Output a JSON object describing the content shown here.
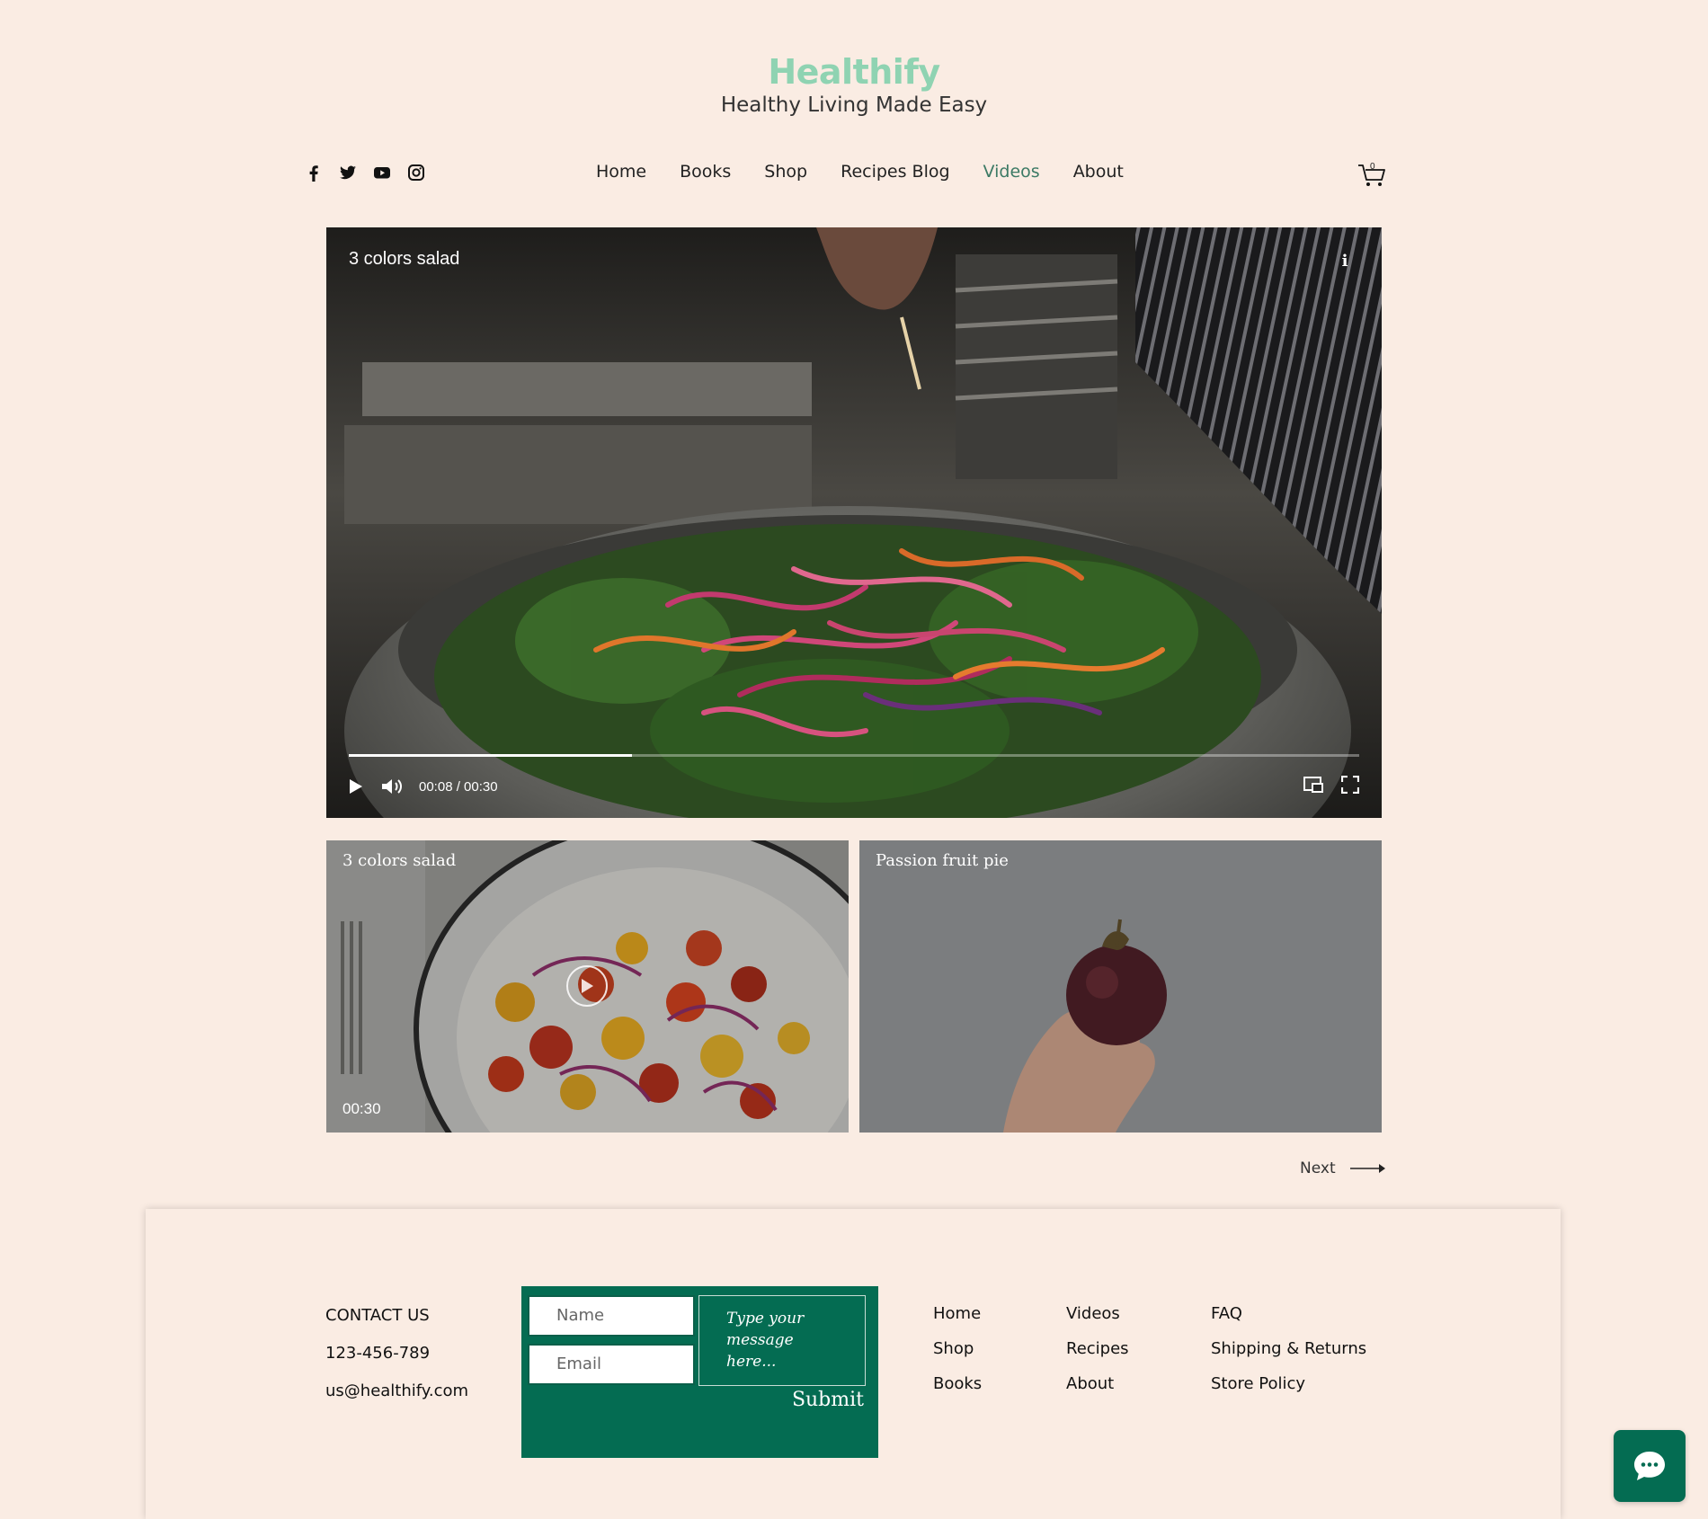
{
  "brand": {
    "name": "Healthify",
    "tagline": "Healthy Living Made Easy",
    "brand_color": "#8fd3b2"
  },
  "social": [
    "facebook-icon",
    "twitter-icon",
    "youtube-icon",
    "instagram-icon"
  ],
  "nav": {
    "items": [
      "Home",
      "Books",
      "Shop",
      "Recipes Blog",
      "Videos",
      "About"
    ],
    "active": "Videos",
    "active_color": "#3c7a65"
  },
  "cart": {
    "count": "0"
  },
  "player": {
    "title": "3 colors salad",
    "info_label": "i",
    "time": "00:08 / 00:30",
    "progress": 0.28
  },
  "thumbnails": [
    {
      "title": "3 colors salad",
      "duration": "00:30"
    },
    {
      "title": "Passion fruit pie"
    }
  ],
  "pager": {
    "next_label": "Next"
  },
  "footer": {
    "contact_title": "CONTACT US",
    "phone": "123-456-789",
    "email": "us@healthify.com",
    "form": {
      "name_placeholder": "Name",
      "email_placeholder": "Email",
      "message_placeholder": "Type your message here...",
      "submit_label": "Submit",
      "form_color": "#046c52"
    },
    "links_col1": [
      "Home",
      "Shop",
      "Books"
    ],
    "links_col2": [
      "Videos",
      "Recipes",
      "About"
    ],
    "links_col3": [
      "FAQ",
      "Shipping & Returns",
      "Store Policy"
    ]
  }
}
